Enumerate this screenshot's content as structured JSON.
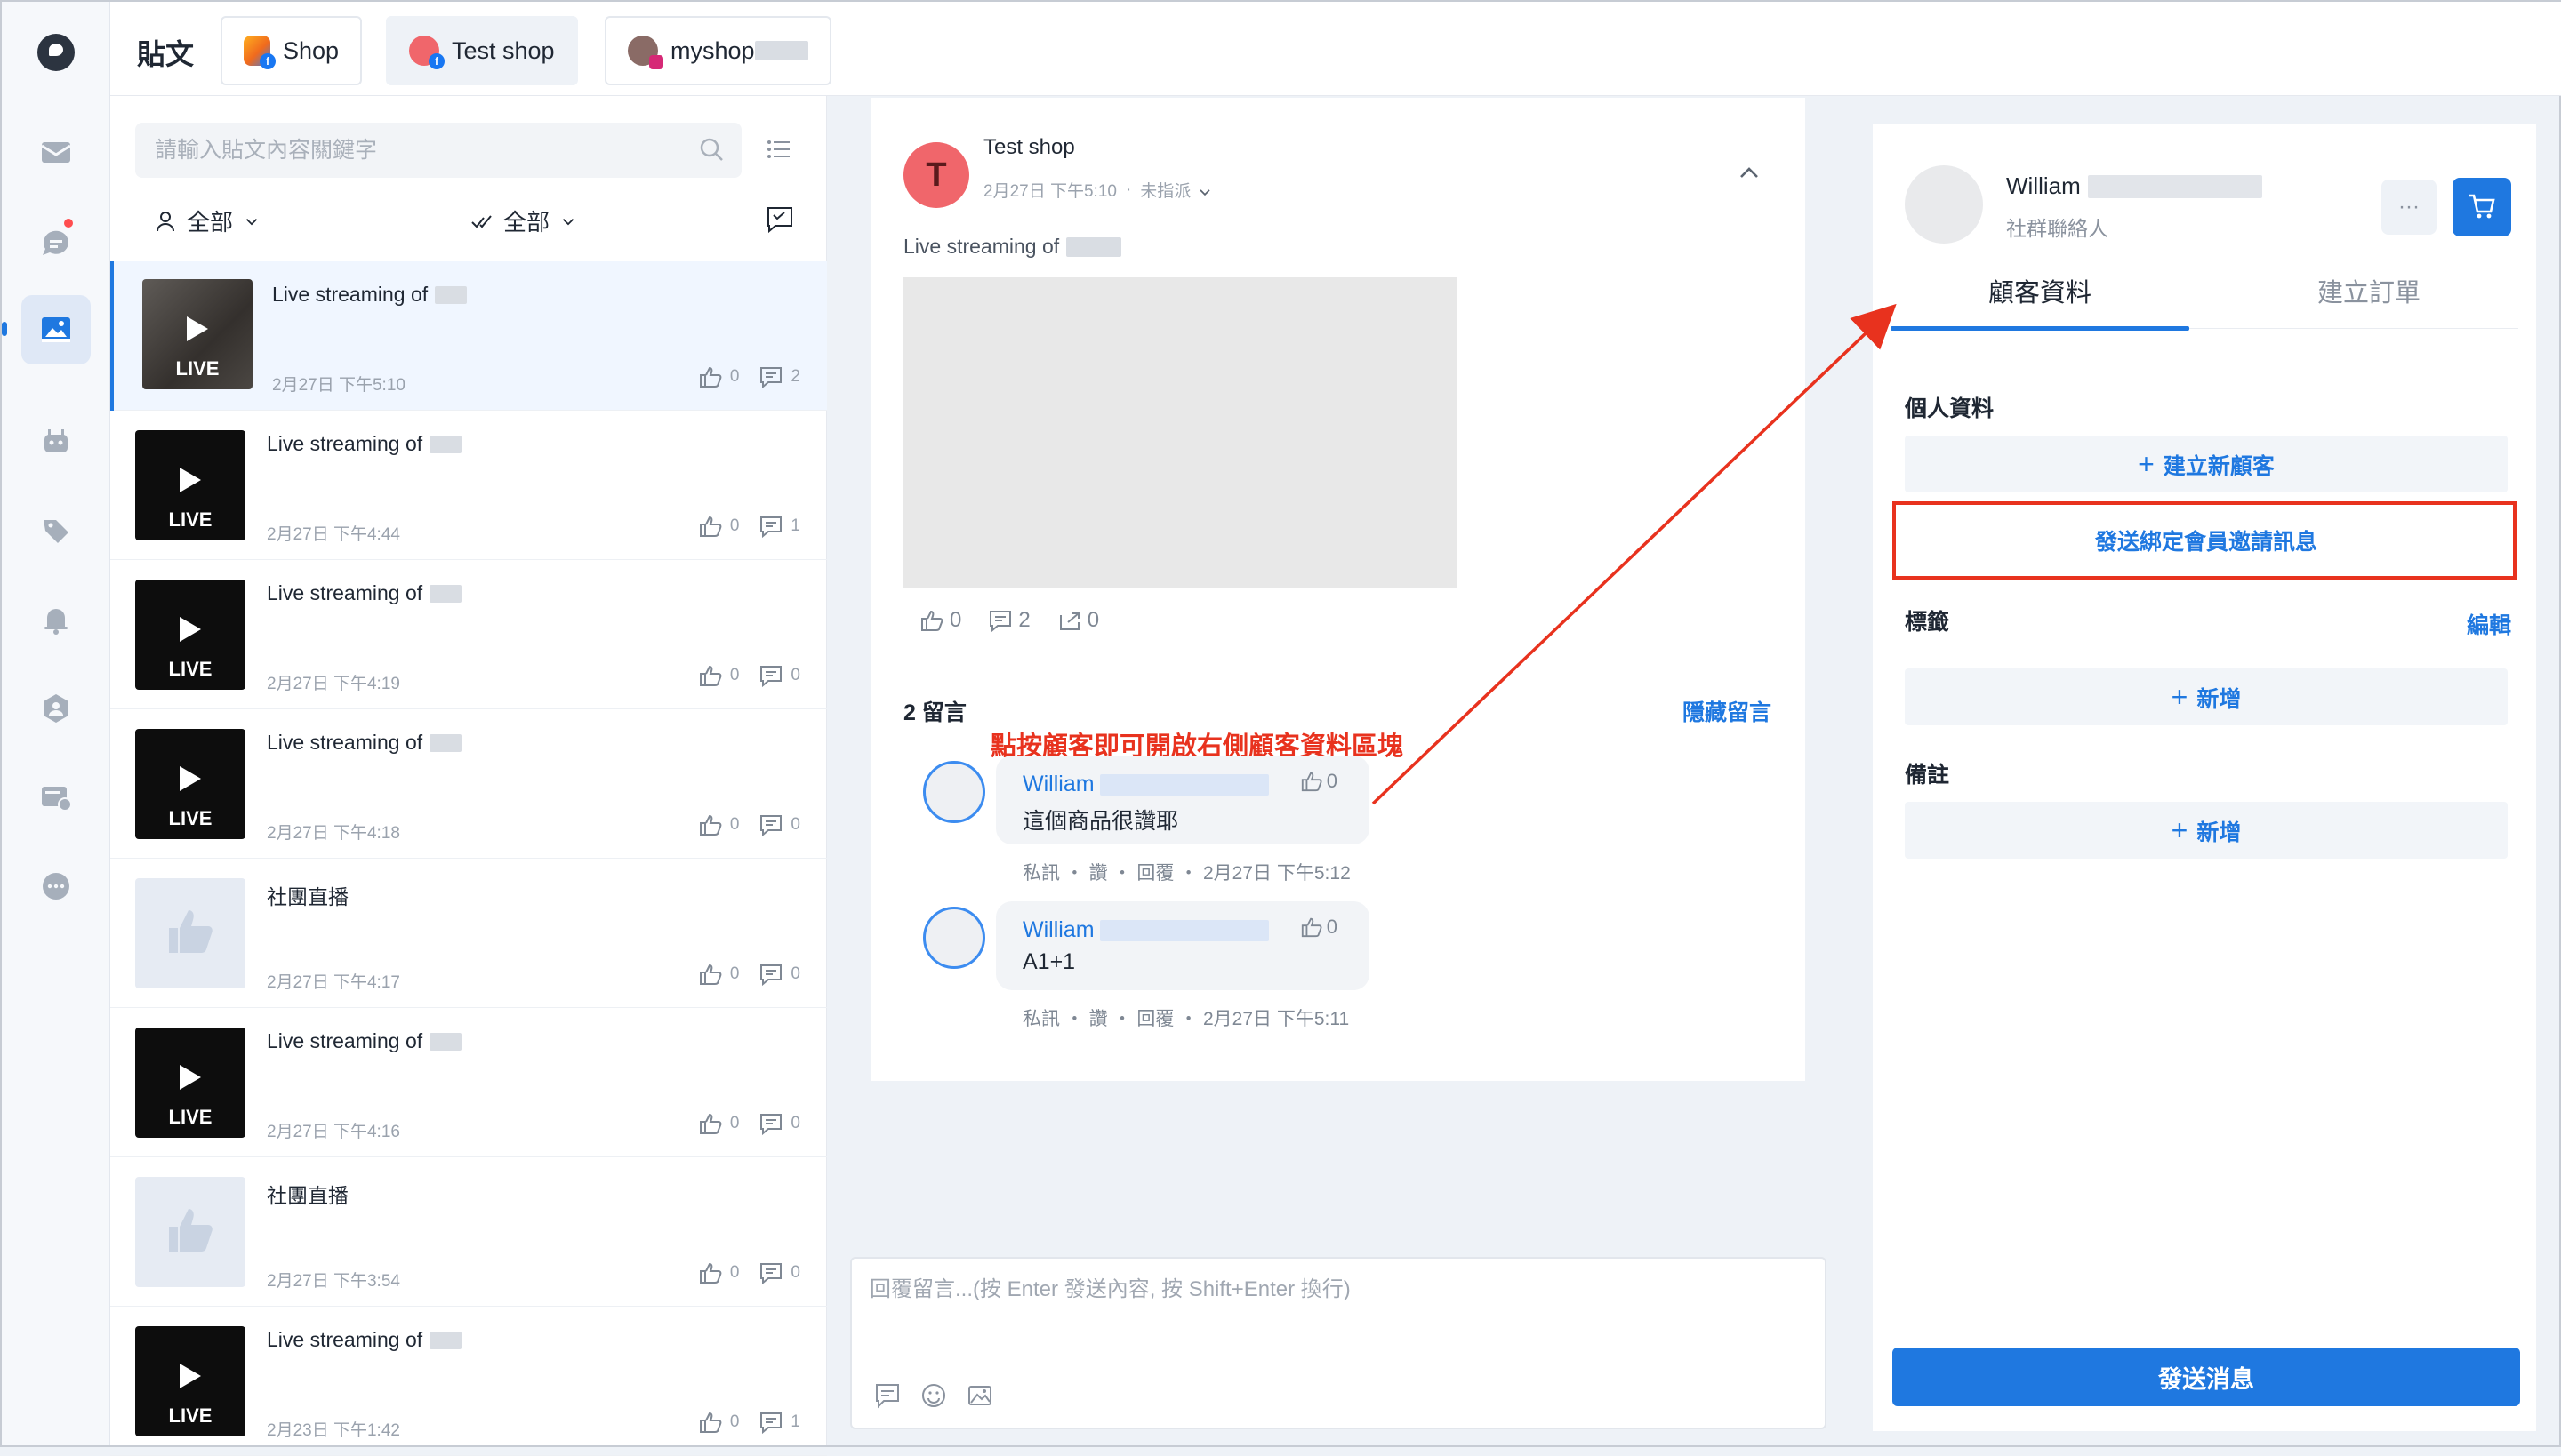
{
  "topbar": {
    "page_title": "貼文",
    "tabs": [
      {
        "label": "Shop",
        "badge": "facebook"
      },
      {
        "label": "Test shop",
        "badge": "facebook"
      },
      {
        "label": "myshop",
        "badge": "instagram"
      }
    ]
  },
  "rail": {
    "items": [
      "inbox-icon",
      "chat-icon",
      "posts-icon",
      "bot-icon",
      "tag-icon",
      "bell-icon",
      "contacts-icon",
      "broadcast-icon",
      "more-icon"
    ]
  },
  "list": {
    "search_placeholder": "請輸入貼文內容關鍵字",
    "filter_assignee": "全部",
    "filter_status": "全部",
    "posts": [
      {
        "title": "Live streaming of",
        "time": "2月27日 下午5:10",
        "likes": "0",
        "comments": "2",
        "thumb": "live",
        "live_label": "LIVE"
      },
      {
        "title": "Live streaming of",
        "time": "2月27日 下午4:44",
        "likes": "0",
        "comments": "1",
        "thumb": "live",
        "live_label": "LIVE"
      },
      {
        "title": "Live streaming of",
        "time": "2月27日 下午4:19",
        "likes": "0",
        "comments": "0",
        "thumb": "live",
        "live_label": "LIVE"
      },
      {
        "title": "Live streaming of",
        "time": "2月27日 下午4:18",
        "likes": "0",
        "comments": "0",
        "thumb": "live",
        "live_label": "LIVE"
      },
      {
        "title": "社團直播",
        "time": "2月27日 下午4:17",
        "likes": "0",
        "comments": "0",
        "thumb": "group",
        "live_label": ""
      },
      {
        "title": "Live streaming of",
        "time": "2月27日 下午4:16",
        "likes": "0",
        "comments": "0",
        "thumb": "live",
        "live_label": "LIVE"
      },
      {
        "title": "社團直播",
        "time": "2月27日 下午3:54",
        "likes": "0",
        "comments": "0",
        "thumb": "group",
        "live_label": ""
      },
      {
        "title": "Live streaming of",
        "time": "2月23日 下午1:42",
        "likes": "0",
        "comments": "1",
        "thumb": "live",
        "live_label": "LIVE"
      }
    ]
  },
  "detail": {
    "avatar_letter": "T",
    "author": "Test shop",
    "time": "2月27日 下午5:10",
    "assign": "未指派",
    "body": "Live streaming of",
    "likes": "0",
    "comments": "2",
    "shares": "0",
    "comment_count": "2 留言",
    "hide_label": "隱藏留言",
    "annotation": "點按顧客即可開啟右側顧客資料區塊",
    "comment_list": [
      {
        "name": "William",
        "text": "這個商品很讚耶",
        "likes": "0",
        "actions": "私訊 ・ 讚 ・ 回覆 ・ 2月27日 下午5:12"
      },
      {
        "name": "William",
        "text": "A1+1",
        "likes": "0",
        "actions": "私訊 ・ 讚 ・ 回覆 ・ 2月27日 下午5:11"
      }
    ]
  },
  "reply": {
    "placeholder": "回覆留言...(按 Enter 發送內容, 按 Shift+Enter 換行)"
  },
  "customer": {
    "name": "William",
    "role": "社群聯絡人",
    "more_label": "···",
    "tabs": [
      "顧客資料",
      "建立訂單"
    ],
    "personal_title": "個人資料",
    "create_customer": "建立新顧客",
    "send_invite": "發送綁定會員邀請訊息",
    "tags_title": "標籤",
    "tags_edit": "編輯",
    "tags_add": "新增",
    "notes_title": "備註",
    "notes_add": "新增",
    "send_message": "發送消息"
  },
  "colors": {
    "accent": "#1f78e0",
    "annotation": "#e8321e",
    "alert_dot": "#ff4d4f"
  }
}
